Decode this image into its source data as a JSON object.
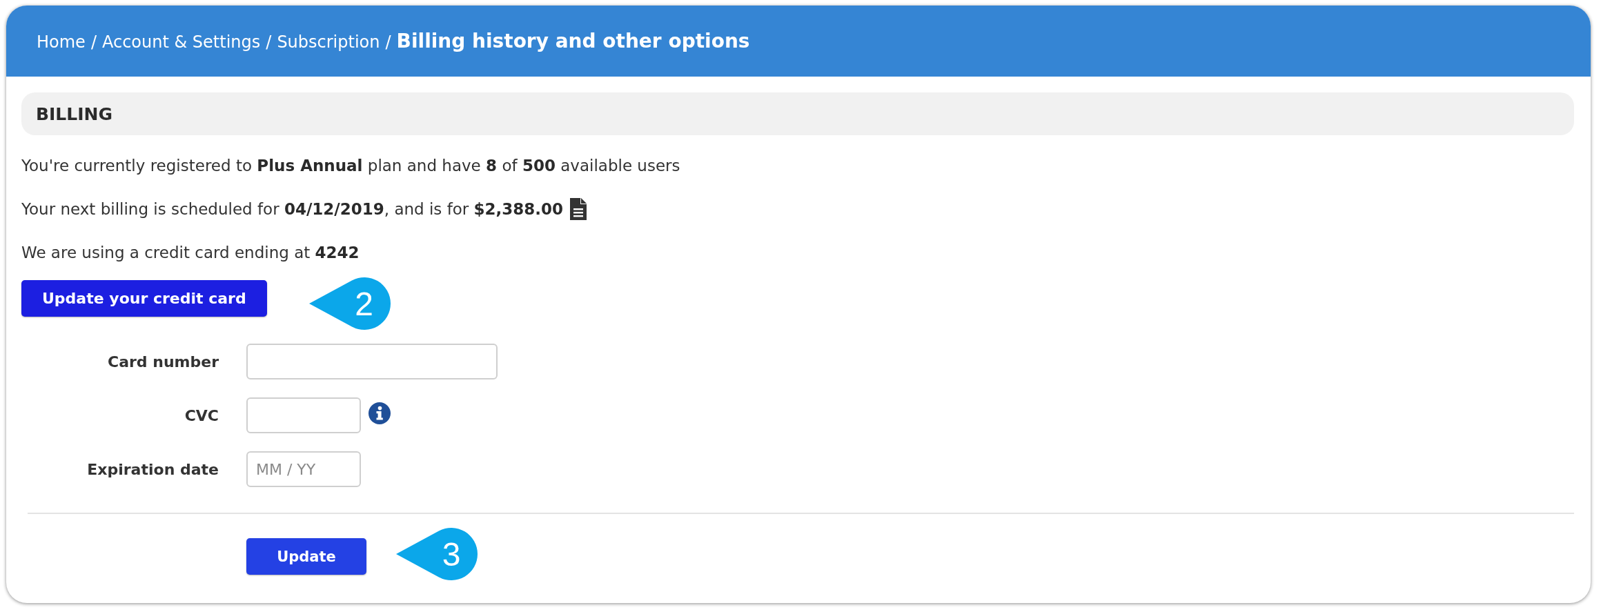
{
  "header": {
    "breadcrumb": [
      {
        "label": "Home",
        "separator": "/",
        "current": false
      },
      {
        "label": "Account & Settings",
        "separator": "/",
        "current": false
      },
      {
        "label": "Subscription",
        "separator": "/",
        "current": false
      },
      {
        "label": "Billing history and other options",
        "current": true
      }
    ]
  },
  "section": {
    "title": "BILLING"
  },
  "summary": [
    {
      "kind": "plain",
      "text": "You're currently registered to **Plus Annual** plan and have **8** of **500** available users"
    },
    {
      "kind": "document",
      "text": "Your next billing is scheduled for **04/12/2019**, and is for **$2,388.00**"
    },
    {
      "kind": "plain",
      "text": "We are using a credit card ending at **4242**"
    }
  ],
  "card_button": {
    "label": "Update your credit card",
    "callout": "2"
  },
  "form": {
    "fields": [
      {
        "kind": "number",
        "label": "Card number"
      },
      {
        "kind": "code",
        "label": "CVC"
      },
      {
        "kind": "date",
        "label": "Expiration date",
        "placeholder": "MM / YY"
      }
    ]
  },
  "submit_button": {
    "label": "Update",
    "callout": "3"
  }
}
